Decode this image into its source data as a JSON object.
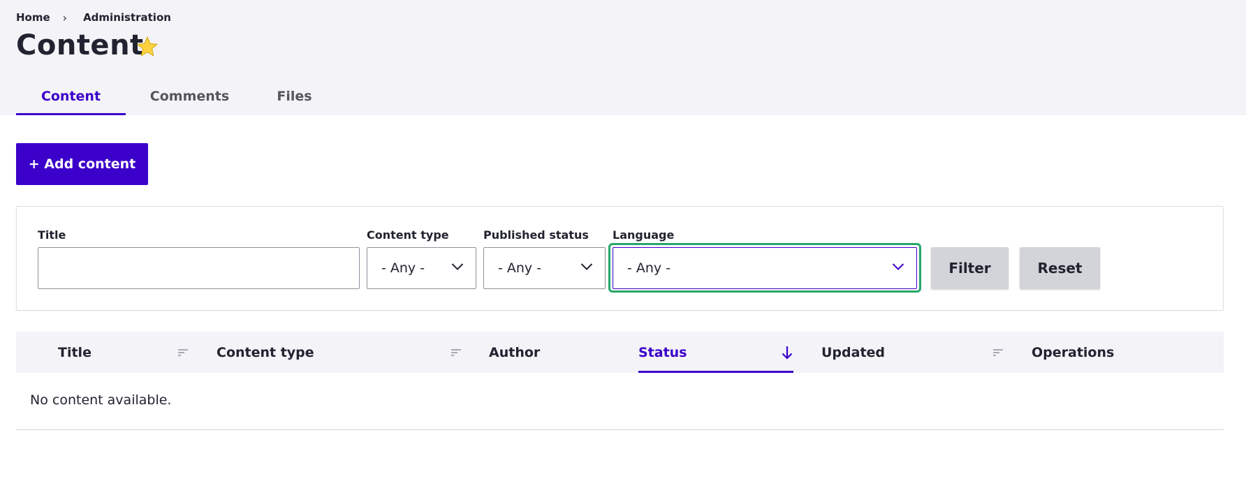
{
  "breadcrumb": {
    "items": [
      "Home",
      "Administration"
    ],
    "separator": "›"
  },
  "page": {
    "title": "Content"
  },
  "tabs": [
    {
      "label": "Content",
      "active": true
    },
    {
      "label": "Comments",
      "active": false
    },
    {
      "label": "Files",
      "active": false
    }
  ],
  "actions": {
    "add_content": "+ Add content"
  },
  "filters": {
    "title": {
      "label": "Title",
      "value": ""
    },
    "content_type": {
      "label": "Content type",
      "value": "- Any -"
    },
    "published_status": {
      "label": "Published status",
      "value": "- Any -"
    },
    "language": {
      "label": "Language",
      "value": "- Any -",
      "focused": true
    },
    "filter_button": "Filter",
    "reset_button": "Reset"
  },
  "table": {
    "columns": [
      {
        "label": "Title",
        "sortable": true
      },
      {
        "label": "Content type",
        "sortable": true
      },
      {
        "label": "Author",
        "sortable": false
      },
      {
        "label": "Status",
        "sortable": true,
        "active_sort": true
      },
      {
        "label": "Updated",
        "sortable": true
      },
      {
        "label": "Operations",
        "sortable": false
      }
    ],
    "empty_message": "No content available."
  },
  "colors": {
    "accent": "#3b00c9",
    "focus_ring": "#26a769",
    "header_bg": "#f3f3f8",
    "star": "#ffd23f",
    "button_gray": "#d3d4d9"
  },
  "icons": {
    "breadcrumb_separator": "chevron-right-icon",
    "favorite": "star-icon",
    "select_arrow": "chevron-down-icon",
    "sort": "sort-icon",
    "sort_active": "arrow-down-icon"
  }
}
